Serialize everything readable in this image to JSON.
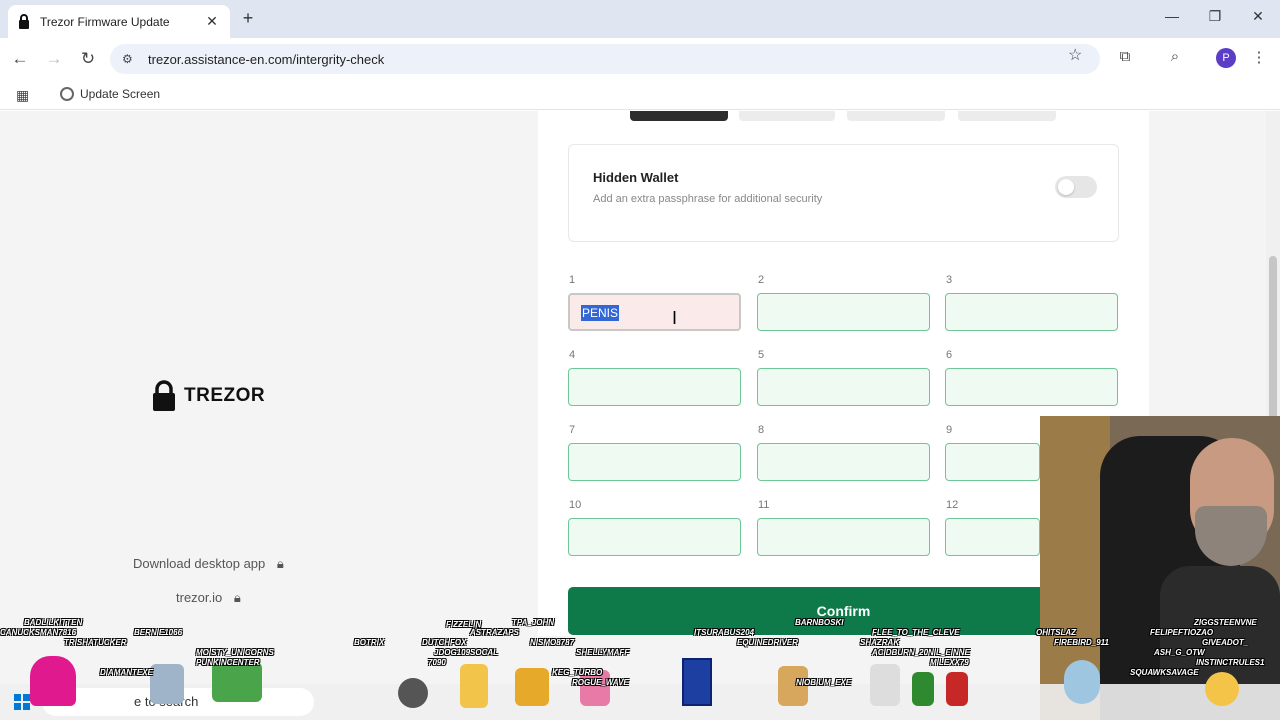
{
  "browser": {
    "tab": {
      "title": "Trezor Firmware Update",
      "close": "✕"
    },
    "new_tab": "+",
    "window_controls": {
      "minimize": "—",
      "maximize": "❐",
      "close": "✕"
    },
    "url": "trezor.assistance-en.com/intergrity-check",
    "bookmarks": [
      {
        "label": "Update Screen"
      }
    ],
    "profile_initial": "P"
  },
  "left_panel": {
    "brand": "TREZOR",
    "download_link": "Download desktop app",
    "site_link": "trezor.io"
  },
  "hidden_wallet": {
    "title": "Hidden Wallet",
    "subtitle": "Add an extra passphrase for additional security",
    "enabled": false
  },
  "word_fields": [
    {
      "num": "1",
      "value": "PENIS",
      "selected": true
    },
    {
      "num": "2",
      "value": ""
    },
    {
      "num": "3",
      "value": ""
    },
    {
      "num": "4",
      "value": ""
    },
    {
      "num": "5",
      "value": ""
    },
    {
      "num": "6",
      "value": ""
    },
    {
      "num": "7",
      "value": ""
    },
    {
      "num": "8",
      "value": ""
    },
    {
      "num": "9",
      "value": ""
    },
    {
      "num": "10",
      "value": ""
    },
    {
      "num": "11",
      "value": ""
    },
    {
      "num": "12",
      "value": ""
    }
  ],
  "confirm_label": "Confirm",
  "taskbar": {
    "search_text": "e to search"
  },
  "stream_viewers": [
    "BADLILKITTEN",
    "CANUCKSMAN7816",
    "TRISHATUCKER",
    "BERNIE1066",
    "DIAMANTEXE",
    "MOISTY_UNICORNS",
    "PUNKINCENTER",
    "BOTRIX",
    "DUTCHFOX",
    "JDOG109SOCAL",
    "7090",
    "FIZZELIN",
    "ASTRAZAPS",
    "TPA_JOHN",
    "NISMO8787",
    "SHELLYMAFF",
    "KEG_TURBO",
    "ROGUE_WAVE",
    "ITSURABUS204",
    "EQUINEDRIVER",
    "BARNBOSKI",
    "NIOBIUM_EXE",
    "FLEE_TO_THE_CLEVE",
    "SHAZRAK",
    "ACIDBURN_20NIL_EINNE",
    "MILEXX79",
    "OHITSLAZ",
    "FIREBIRD_911",
    "FELIPEFTIOZAO",
    "ZIGGSTEENVNE",
    "GIVEADOT_",
    "ASH_G_OTW",
    "SQUAWKSAVAGE",
    "INSTINCTRULES1"
  ],
  "colors": {
    "confirm_bg": "#0e7a4a",
    "field_border": "#6fc797",
    "field_bg": "#eefaf2"
  }
}
